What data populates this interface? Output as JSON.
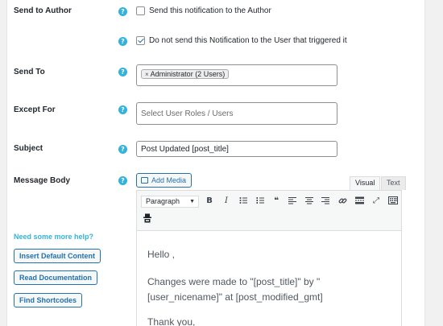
{
  "fields": {
    "send_to_author": {
      "label": "Send to Author",
      "help": "?",
      "checkbox_label": "Send this notification to the Author",
      "checked": false
    },
    "dont_send_trigger": {
      "help": "?",
      "checkbox_label": "Do not send this Notification to the User that triggered it",
      "checked": true
    },
    "send_to": {
      "label": "Send To",
      "help": "?",
      "tag_remove": "×",
      "tag_label": "Administrator (2 Users)"
    },
    "except_for": {
      "label": "Except For",
      "help": "?",
      "placeholder": "Select User Roles / Users"
    },
    "subject": {
      "label": "Subject",
      "help": "?",
      "value": "Post Updated [post_title]"
    },
    "message_body": {
      "label": "Message Body",
      "help": "?"
    }
  },
  "editor": {
    "add_media_label": "Add Media",
    "tabs": {
      "visual": "Visual",
      "text": "Text"
    },
    "format_select": "Paragraph",
    "toolbar_icons": [
      "bold-icon",
      "italic-icon",
      "bullet-list-icon",
      "numbered-list-icon",
      "blockquote-icon",
      "align-left-icon",
      "align-center-icon",
      "align-right-icon",
      "link-icon",
      "read-more-icon",
      "fullscreen-icon",
      "toolbar-toggle-icon",
      "merge-tag-icon"
    ],
    "toolbar_glyphs": {
      "bold": "B",
      "italic": "I",
      "blockquote": "❝",
      "fullscreen": "⤢"
    },
    "content": {
      "p1": "Hello ,",
      "p2": "Changes were made to \"[post_title]\" by \"[user_nicename]\" at [post_modified_gmt]",
      "p3": "Thank you,"
    }
  },
  "help_sidebar": {
    "title": "Need some more help?",
    "buttons": {
      "insert_default": "Insert Default Content",
      "read_docs": "Read Documentation",
      "find_shortcodes": "Find Shortcodes"
    }
  },
  "colors": {
    "accent": "#2271b1",
    "help": "#33b3db"
  }
}
